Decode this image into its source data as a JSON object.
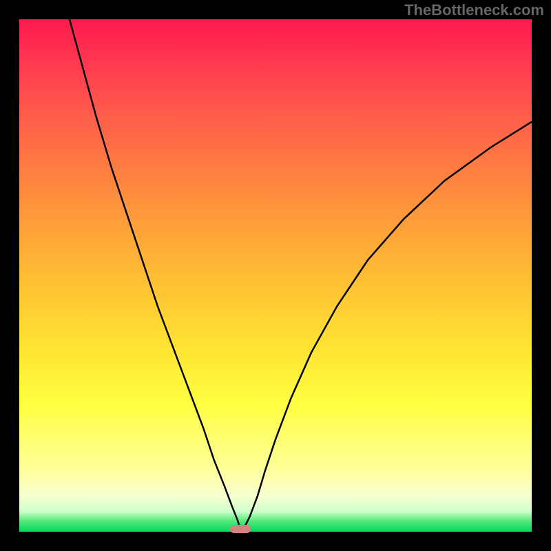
{
  "watermark": "TheBottleneck.com",
  "chart_data": {
    "type": "line",
    "title": "",
    "xlabel": "",
    "ylabel": "",
    "xlim": [
      0,
      100
    ],
    "ylim": [
      0,
      100
    ],
    "series": [
      {
        "name": "curve",
        "x": [
          9.8,
          12,
          15,
          18,
          21,
          24,
          27,
          30,
          33,
          36,
          38,
          40,
          41.5,
          42.5,
          43,
          43.5,
          44,
          45,
          46.5,
          48,
          50,
          53,
          57,
          62,
          68,
          75,
          83,
          92,
          100
        ],
        "y": [
          100,
          92,
          81,
          71,
          62,
          53,
          44,
          36,
          28,
          20,
          14,
          9,
          5,
          2.5,
          1,
          0.3,
          1,
          3,
          7,
          12,
          18,
          26,
          35,
          44,
          53,
          61,
          68.5,
          75,
          80
        ]
      }
    ],
    "marker": {
      "x": 43.2,
      "y": 0.6
    },
    "background_gradient": {
      "top": "#ff1a4d",
      "mid": "#ffe633",
      "bottom": "#00d860"
    }
  }
}
